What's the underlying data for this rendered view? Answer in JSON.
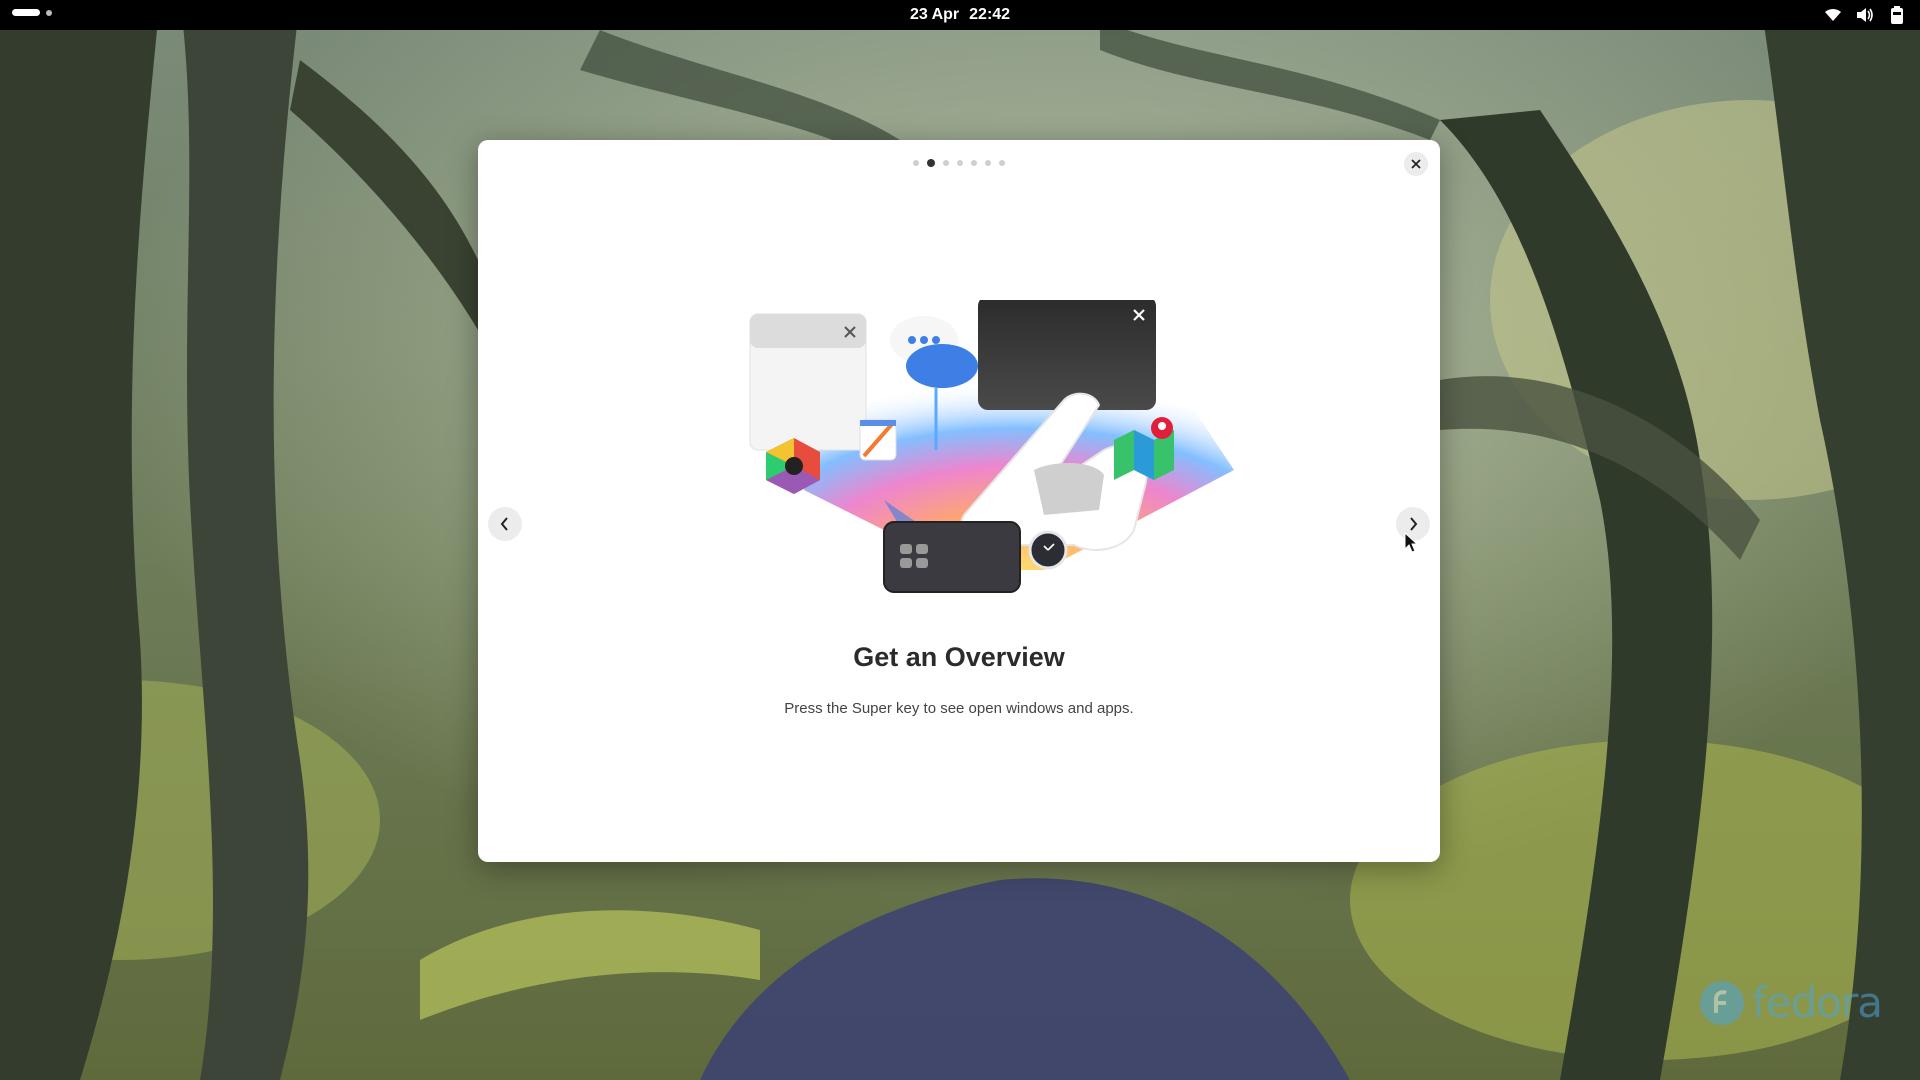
{
  "topbar": {
    "date": "23 Apr",
    "time": "22:42",
    "icons": [
      "wifi-icon",
      "volume-icon",
      "battery-icon"
    ]
  },
  "dialog": {
    "page_count": 7,
    "active_page": 2,
    "title": "Get an Overview",
    "description": "Press the Super key to see open windows and apps.",
    "icons": [
      "close-icon",
      "chevron-left-icon",
      "chevron-right-icon"
    ]
  },
  "watermark": {
    "text": "fedora"
  },
  "colors": {
    "topbar": "#000000",
    "dialog": "#ffffff",
    "fedora_blue": "#4fa6d6"
  }
}
